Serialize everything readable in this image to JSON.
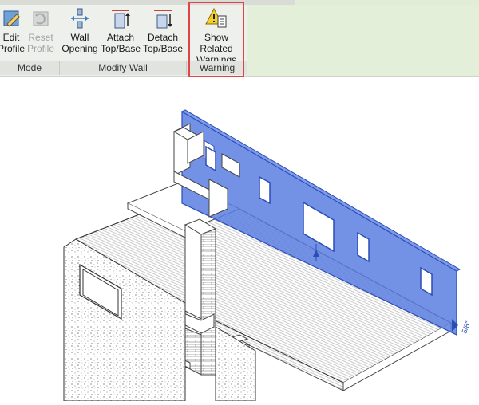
{
  "ribbon": {
    "tools": {
      "edit_profile": "Edit\nProfile",
      "reset_profile": "Reset\nProfile",
      "wall_opening": "Wall\nOpening",
      "attach_top_base": "Attach\nTop/Base",
      "detach_top_base": "Detach\nTop/Base",
      "show_related_warnings": "Show Related\nWarnings"
    },
    "panels": {
      "mode": "Mode",
      "modify_wall": "Modify Wall",
      "warning": "Warning"
    }
  },
  "viewport": {
    "dimension_label": "5/8\""
  },
  "colors": {
    "selected_wall": "#5b7fe0",
    "highlight_border": "#e04545"
  }
}
